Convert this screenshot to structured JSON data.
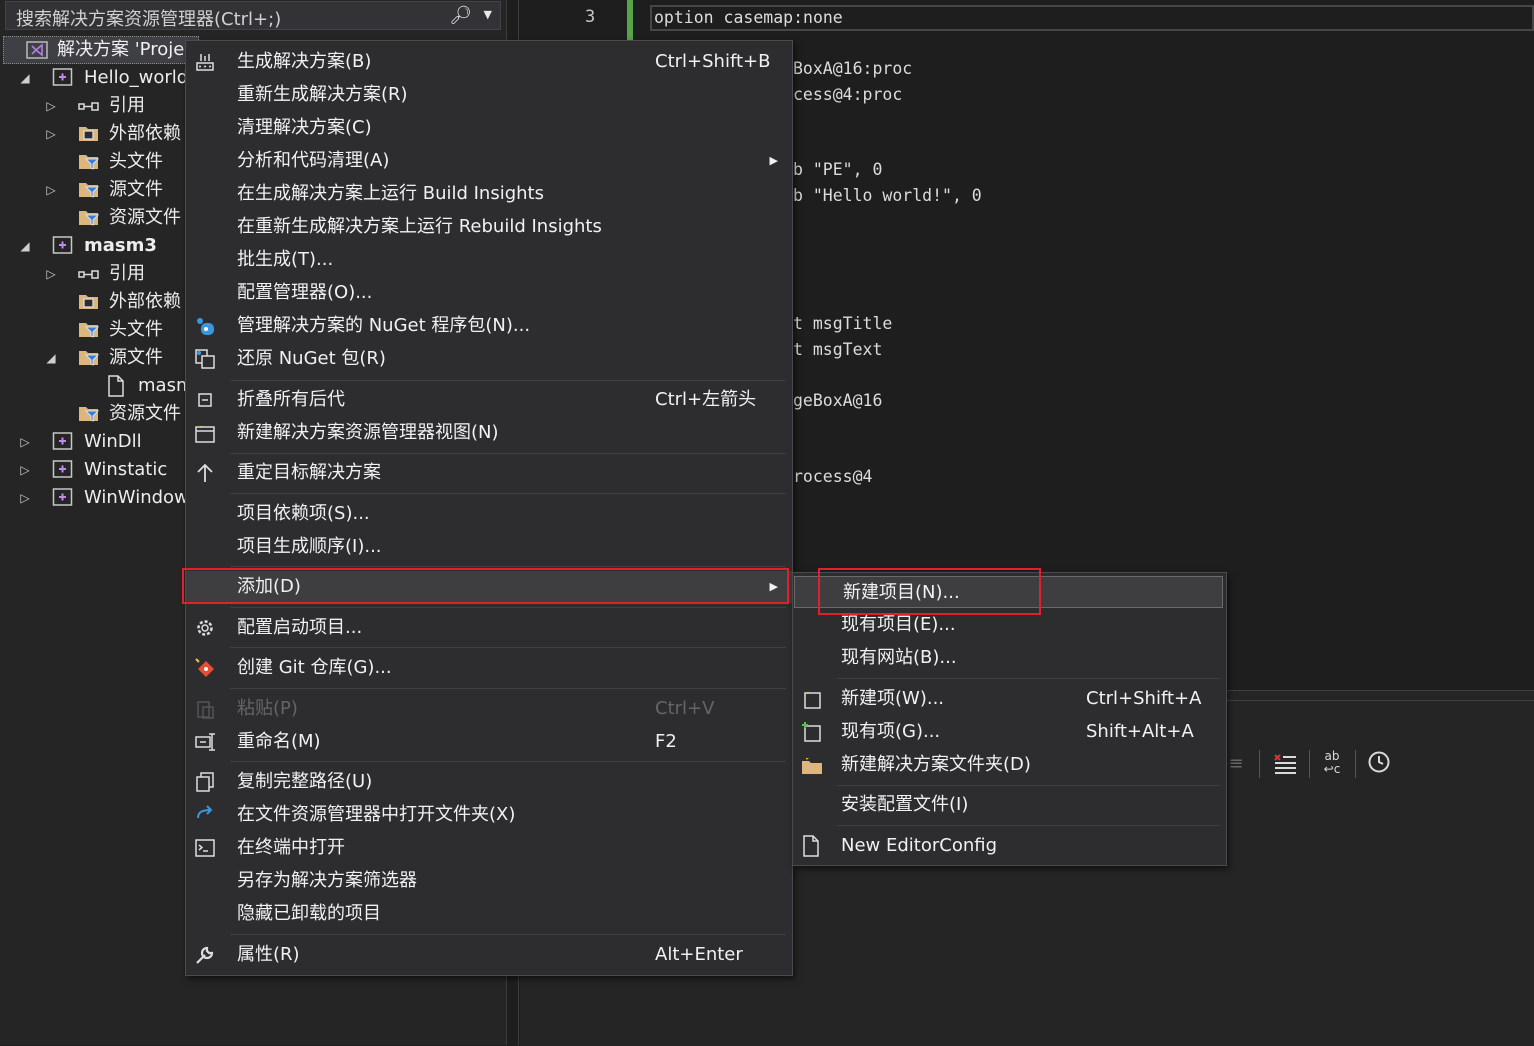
{
  "explorer": {
    "search_placeholder": "搜索解决方案资源管理器(Ctrl+;)",
    "root": "解决方案 'Proje",
    "items": [
      {
        "label": "Hello_world",
        "arrow": "◢"
      },
      {
        "label": "引用",
        "arrow": "▷"
      },
      {
        "label": "外部依赖",
        "arrow": "▷"
      },
      {
        "label": "头文件",
        "arrow": ""
      },
      {
        "label": "源文件",
        "arrow": "▷"
      },
      {
        "label": "资源文件",
        "arrow": ""
      },
      {
        "label": "masm3",
        "arrow": "◢"
      },
      {
        "label": "引用",
        "arrow": "▷"
      },
      {
        "label": "外部依赖",
        "arrow": ""
      },
      {
        "label": "头文件",
        "arrow": ""
      },
      {
        "label": "源文件",
        "arrow": "◢"
      },
      {
        "label": "masm",
        "arrow": ""
      },
      {
        "label": "资源文件",
        "arrow": ""
      },
      {
        "label": "WinDll",
        "arrow": "▷"
      },
      {
        "label": "Winstatic",
        "arrow": "▷"
      },
      {
        "label": "WinWindow",
        "arrow": "▷"
      }
    ]
  },
  "editor": {
    "line_number": "3",
    "lines": [
      "option casemap:none",
      "BoxA@16:proc",
      "cess@4:proc",
      "b \"PE\", 0",
      "b \"Hello world!\", 0",
      "t msgTitle",
      "t msgText",
      "geBoxA@16",
      "rocess@4"
    ]
  },
  "context_menu": {
    "items": [
      {
        "label": "生成解决方案(B)",
        "shortcut": "Ctrl+Shift+B",
        "icon": "build-icon"
      },
      {
        "label": "重新生成解决方案(R)",
        "shortcut": "",
        "icon": ""
      },
      {
        "label": "清理解决方案(C)",
        "shortcut": "",
        "icon": ""
      },
      {
        "label": "分析和代码清理(A)",
        "shortcut": "",
        "icon": ""
      },
      {
        "label": "在生成解决方案上运行 Build Insights",
        "shortcut": "",
        "icon": ""
      },
      {
        "label": "在重新生成解决方案上运行 Rebuild Insights",
        "shortcut": "",
        "icon": ""
      },
      {
        "label": "批生成(T)...",
        "shortcut": "",
        "icon": ""
      },
      {
        "label": "配置管理器(O)...",
        "shortcut": "",
        "icon": ""
      },
      {
        "label": "管理解决方案的 NuGet 程序包(N)...",
        "shortcut": "",
        "icon": "nuget-icon"
      },
      {
        "label": "还原 NuGet 包(R)",
        "shortcut": "",
        "icon": "restore-icon"
      },
      {
        "label": "折叠所有后代",
        "shortcut": "Ctrl+左箭头",
        "icon": "collapse-icon"
      },
      {
        "label": "新建解决方案资源管理器视图(N)",
        "shortcut": "",
        "icon": "new-view-icon"
      },
      {
        "label": "重定目标解决方案",
        "shortcut": "",
        "icon": "arrow-up-icon"
      },
      {
        "label": "项目依赖项(S)...",
        "shortcut": "",
        "icon": ""
      },
      {
        "label": "项目生成顺序(I)...",
        "shortcut": "",
        "icon": ""
      },
      {
        "label": "添加(D)",
        "shortcut": "",
        "icon": ""
      },
      {
        "label": "配置启动项目...",
        "shortcut": "",
        "icon": "gear-icon"
      },
      {
        "label": "创建 Git 仓库(G)...",
        "shortcut": "",
        "icon": "git-icon"
      },
      {
        "label": "粘贴(P)",
        "shortcut": "Ctrl+V",
        "icon": "paste-icon"
      },
      {
        "label": "重命名(M)",
        "shortcut": "F2",
        "icon": "rename-icon"
      },
      {
        "label": "复制完整路径(U)",
        "shortcut": "",
        "icon": "copy-icon"
      },
      {
        "label": "在文件资源管理器中打开文件夹(X)",
        "shortcut": "",
        "icon": "open-folder-icon"
      },
      {
        "label": "在终端中打开",
        "shortcut": "",
        "icon": "terminal-icon"
      },
      {
        "label": "另存为解决方案筛选器",
        "shortcut": "",
        "icon": ""
      },
      {
        "label": "隐藏已卸载的项目",
        "shortcut": "",
        "icon": ""
      },
      {
        "label": "属性(R)",
        "shortcut": "Alt+Enter",
        "icon": "wrench-icon"
      }
    ]
  },
  "submenu": {
    "items": [
      {
        "label": "新建项目(N)...",
        "shortcut": ""
      },
      {
        "label": "现有项目(E)...",
        "shortcut": ""
      },
      {
        "label": "现有网站(B)...",
        "shortcut": ""
      },
      {
        "label": "新建项(W)...",
        "shortcut": "Ctrl+Shift+A"
      },
      {
        "label": "现有项(G)...",
        "shortcut": "Shift+Alt+A"
      },
      {
        "label": "新建解决方案文件夹(D)",
        "shortcut": ""
      },
      {
        "label": "安装配置文件(I)",
        "shortcut": ""
      },
      {
        "label": "New EditorConfig",
        "shortcut": ""
      }
    ]
  },
  "colors": {
    "highlight": "#e0212c",
    "accent_green": "#57a64a"
  }
}
